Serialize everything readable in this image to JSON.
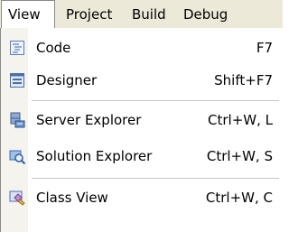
{
  "menubar": {
    "items": [
      {
        "label": "View",
        "active": true
      },
      {
        "label": "Project"
      },
      {
        "label": "Build"
      },
      {
        "label": "Debug"
      }
    ]
  },
  "dropdown": {
    "items": [
      {
        "label": "Code",
        "shortcut": "F7",
        "icon": "code-icon"
      },
      {
        "label": "Designer",
        "shortcut": "Shift+F7",
        "icon": "designer-icon"
      },
      {
        "label": "Server Explorer",
        "shortcut": "Ctrl+W, L",
        "icon": "server-explorer-icon"
      },
      {
        "label": "Solution Explorer",
        "shortcut": "Ctrl+W, S",
        "icon": "solution-explorer-icon"
      },
      {
        "label": "Class View",
        "shortcut": "Ctrl+W, C",
        "icon": "class-view-icon"
      }
    ]
  },
  "colors": {
    "menubar_bg": "#ece9d8",
    "menu_bg": "#ffffff",
    "icon_strip_bg": "#f4f3ee",
    "separator": "#c5c5c5"
  }
}
